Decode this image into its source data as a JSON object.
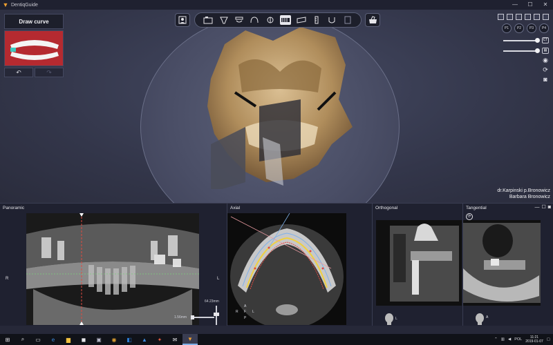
{
  "window": {
    "title": "DentiqGuide",
    "minimize": "—",
    "maximize": "☐",
    "close": "✕"
  },
  "left_panel": {
    "draw_curve_label": "Draw curve",
    "undo": "↶",
    "redo": "↷"
  },
  "toolbar": {
    "tools": [
      "camera-tool",
      "tooth-tool",
      "implant-tool",
      "arch-tool",
      "nerve-tool",
      "sleeve-tool",
      "scan-tool",
      "ruler-tool",
      "bone-tool",
      "guide-tool",
      "export-tool"
    ]
  },
  "right_tools": {
    "presets": [
      "P1",
      "P2",
      "P3",
      "P4"
    ]
  },
  "patient": {
    "doctor": "dr.Karpinski p.Bronowicz",
    "name": "Barbara Bronowicz"
  },
  "panes": {
    "panoramic": {
      "title": "Panoramic",
      "left_label": "R",
      "right_label": "L",
      "measure": "64.23mm",
      "zoom": "1.56mm"
    },
    "axial": {
      "title": "Axial",
      "orient_top": "A",
      "orient_left": "R",
      "orient_center": "F",
      "orient_right": "L",
      "orient_bottom": "P"
    },
    "orthogonal": {
      "title": "Orthogonal",
      "orient_letter": "L"
    },
    "tangential": {
      "title": "Tangential",
      "orient_letter": "A"
    }
  },
  "taskbar": {
    "language": "POL",
    "time": "11:21",
    "date": "2019-01-07"
  },
  "colors": {
    "background": "#2b2d3a",
    "panel": "#1f2130",
    "accent": "#f0a030",
    "curve_yellow": "#f0d040",
    "curve_red": "#e04a40",
    "curve_blue": "#7fb0e8"
  }
}
